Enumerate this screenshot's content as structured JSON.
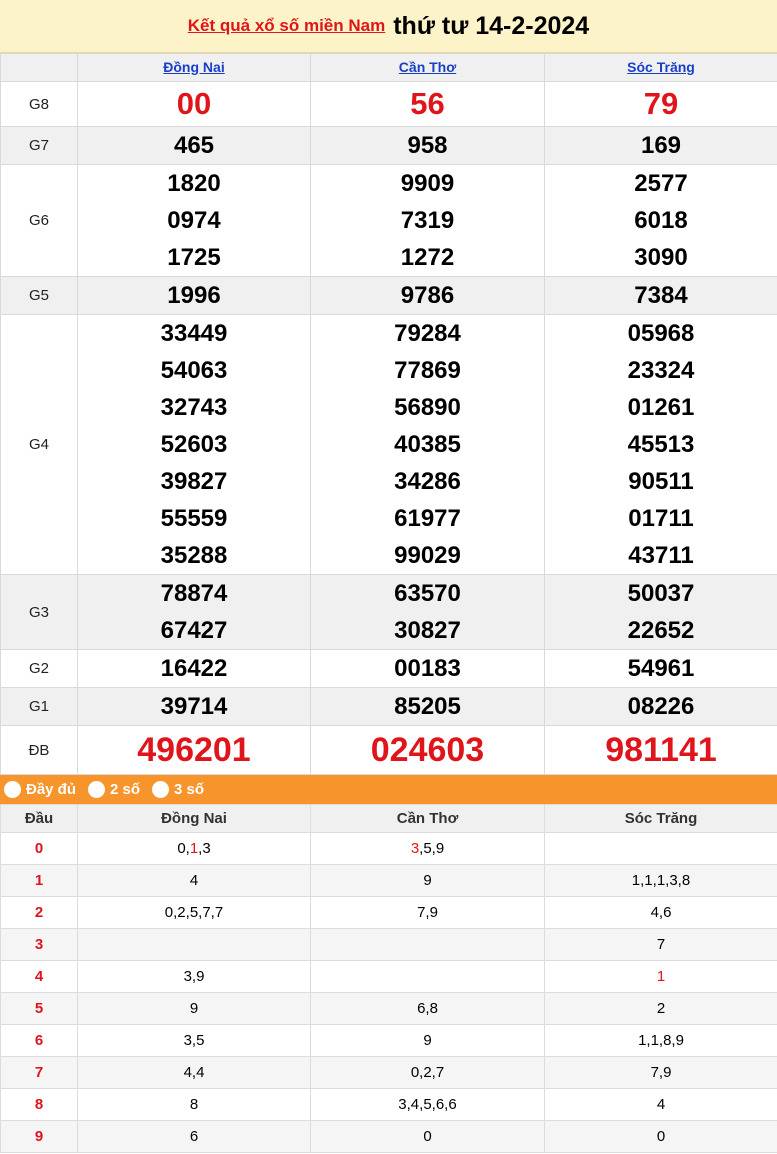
{
  "header": {
    "link_text": "Kết quả xổ số miền Nam",
    "date_text": "thứ tư 14-2-2024"
  },
  "provinces": [
    "Đồng Nai",
    "Cần Thơ",
    "Sóc Trăng"
  ],
  "prizes": [
    {
      "label": "G8",
      "values": [
        [
          "00"
        ],
        [
          "56"
        ],
        [
          "79"
        ]
      ]
    },
    {
      "label": "G7",
      "values": [
        [
          "465"
        ],
        [
          "958"
        ],
        [
          "169"
        ]
      ]
    },
    {
      "label": "G6",
      "values": [
        [
          "1820",
          "0974",
          "1725"
        ],
        [
          "9909",
          "7319",
          "1272"
        ],
        [
          "2577",
          "6018",
          "3090"
        ]
      ]
    },
    {
      "label": "G5",
      "values": [
        [
          "1996"
        ],
        [
          "9786"
        ],
        [
          "7384"
        ]
      ]
    },
    {
      "label": "G4",
      "values": [
        [
          "33449",
          "54063",
          "32743",
          "52603",
          "39827",
          "55559",
          "35288"
        ],
        [
          "79284",
          "77869",
          "56890",
          "40385",
          "34286",
          "61977",
          "99029"
        ],
        [
          "05968",
          "23324",
          "01261",
          "45513",
          "90511",
          "01711",
          "43711"
        ]
      ]
    },
    {
      "label": "G3",
      "values": [
        [
          "78874",
          "67427"
        ],
        [
          "63570",
          "30827"
        ],
        [
          "50037",
          "22652"
        ]
      ]
    },
    {
      "label": "G2",
      "values": [
        [
          "16422"
        ],
        [
          "00183"
        ],
        [
          "54961"
        ]
      ]
    },
    {
      "label": "G1",
      "values": [
        [
          "39714"
        ],
        [
          "85205"
        ],
        [
          "08226"
        ]
      ]
    },
    {
      "label": "ĐB",
      "values": [
        [
          "496201"
        ],
        [
          "024603"
        ],
        [
          "981141"
        ]
      ]
    }
  ],
  "filters": [
    "Đầy đủ",
    "2 số",
    "3 số"
  ],
  "loto": {
    "head_label": "Đầu",
    "rows": [
      {
        "head": "0",
        "cells": [
          "0,1,3",
          "3,5,9",
          ""
        ]
      },
      {
        "head": "1",
        "cells": [
          "4",
          "9",
          "1,1,1,3,8"
        ]
      },
      {
        "head": "2",
        "cells": [
          "0,2,5,7,7",
          "7,9",
          "4,6"
        ]
      },
      {
        "head": "3",
        "cells": [
          "",
          "",
          "7"
        ]
      },
      {
        "head": "4",
        "cells": [
          "3,9",
          "",
          "1"
        ]
      },
      {
        "head": "5",
        "cells": [
          "9",
          "6,8",
          "2"
        ]
      },
      {
        "head": "6",
        "cells": [
          "3,5",
          "9",
          "1,1,8,9"
        ]
      },
      {
        "head": "7",
        "cells": [
          "4,4",
          "0,2,7",
          "7,9"
        ]
      },
      {
        "head": "8",
        "cells": [
          "8",
          "3,4,5,6,6",
          "4"
        ]
      },
      {
        "head": "9",
        "cells": [
          "6",
          "0",
          "0"
        ]
      }
    ],
    "special_tails": [
      [
        "0",
        "1"
      ],
      [
        "0",
        "3"
      ],
      [
        "4",
        "1"
      ]
    ]
  },
  "colors": {
    "accent_red": "#e0151b",
    "link_blue": "#1a3fc9",
    "title_bg": "#fdf3c8",
    "filter_bar": "#f7942b"
  }
}
